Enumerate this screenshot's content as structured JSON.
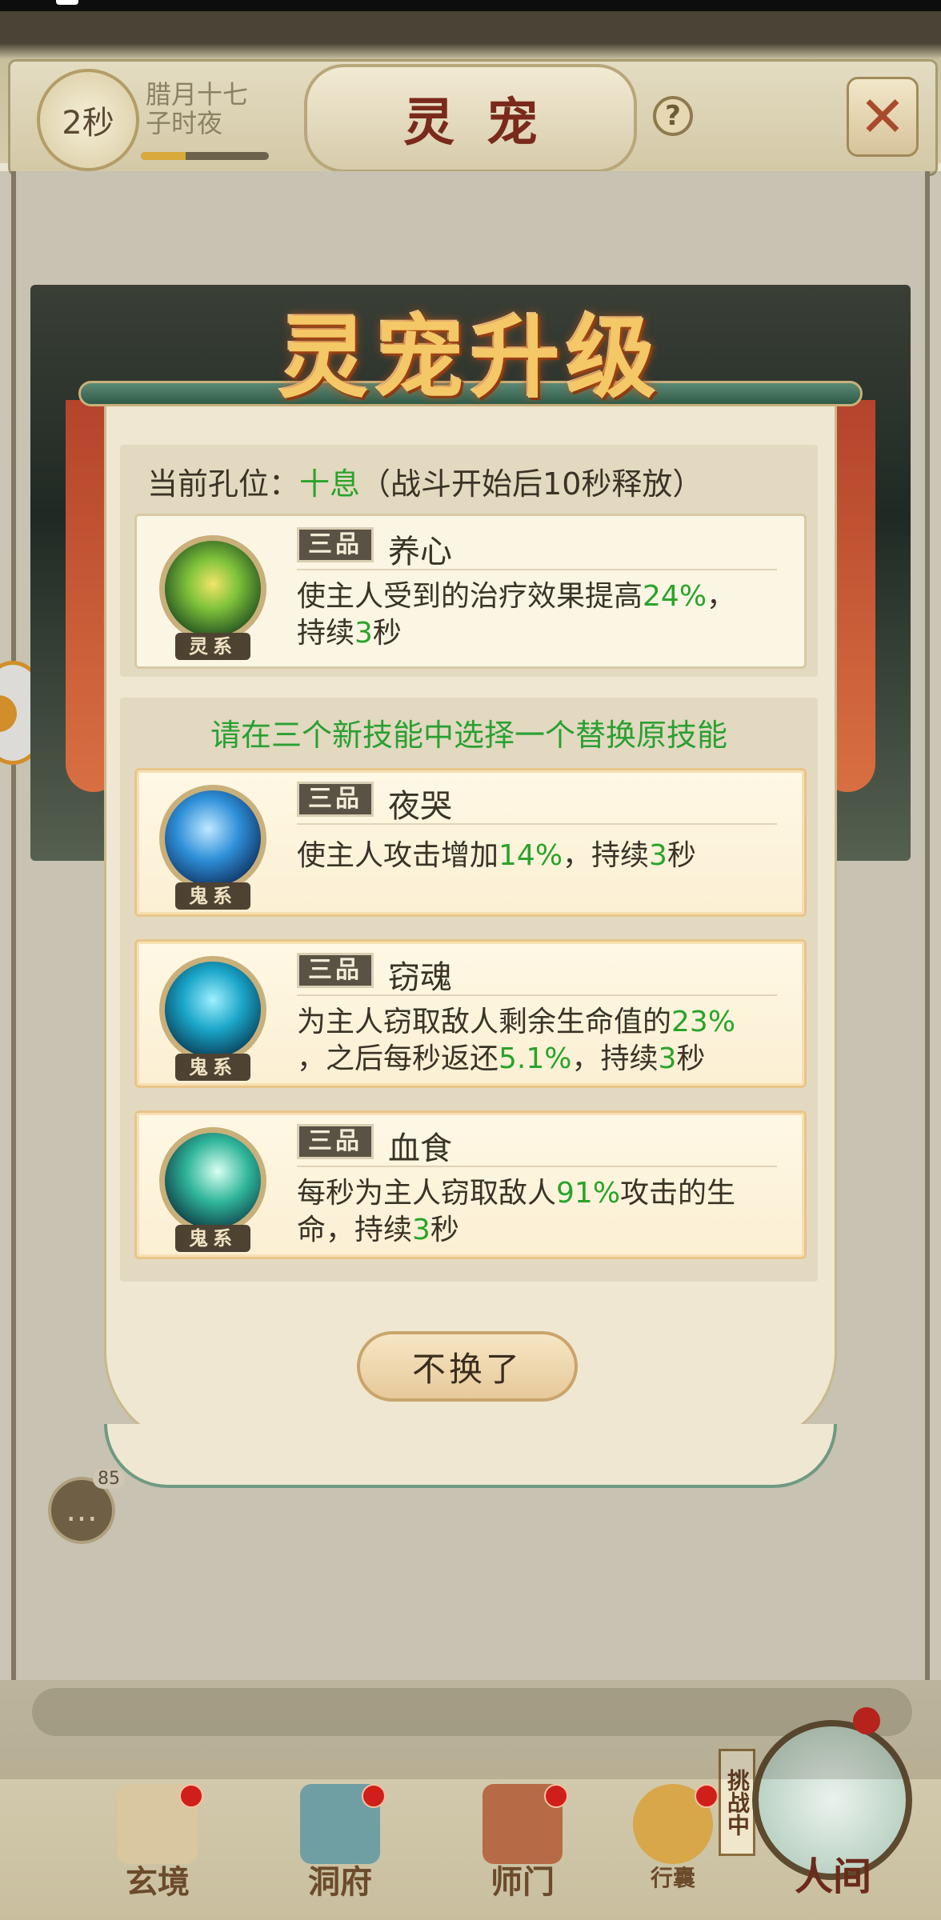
{
  "header": {
    "timer": "2秒",
    "calendar_line1": "腊月十七",
    "calendar_line2": "子时夜",
    "timer_progress": 0.35,
    "title": "灵宠",
    "help_glyph": "?"
  },
  "chat": {
    "count": "85"
  },
  "modal": {
    "title": "灵宠升级",
    "current_slot_label": "当前孔位：",
    "current_slot_name": "十息",
    "current_slot_note": "（战斗开始后10秒释放）",
    "current_skill": {
      "grade": "三品",
      "name": "养心",
      "element": "灵系",
      "desc_parts": [
        "使主人受到的治疗效果提高",
        "24%",
        "，",
        "持续",
        "3",
        "秒"
      ]
    },
    "choose_prompt": "请在三个新技能中选择一个替换原技能",
    "options": [
      {
        "grade": "三品",
        "name": "夜哭",
        "element": "鬼系",
        "desc_parts": [
          "使主人攻击增加",
          "14%",
          "，持续",
          "3",
          "秒"
        ]
      },
      {
        "grade": "三品",
        "name": "窃魂",
        "element": "鬼系",
        "desc_parts": [
          "为主人窃取敌人剩余生命值的",
          "23%",
          "，之后每秒返还",
          "5.1%",
          "，持续",
          "3",
          "秒"
        ]
      },
      {
        "grade": "三品",
        "name": "血食",
        "element": "鬼系",
        "desc_parts": [
          "每秒为主人窃取敌人",
          "91%",
          "攻击的生",
          "命，持续",
          "3",
          "秒"
        ]
      }
    ],
    "cancel_label": "不换了"
  },
  "bottom_nav": {
    "items": [
      {
        "label": "玄境"
      },
      {
        "label": "洞府"
      },
      {
        "label": "师门"
      },
      {
        "label": "行囊"
      }
    ],
    "challenge_label": "挑战中",
    "world_label": "人间"
  },
  "colors": {
    "highlight_green": "#2aa32a",
    "title_gold": "#f4c866",
    "badge_red": "#d01f1a"
  }
}
